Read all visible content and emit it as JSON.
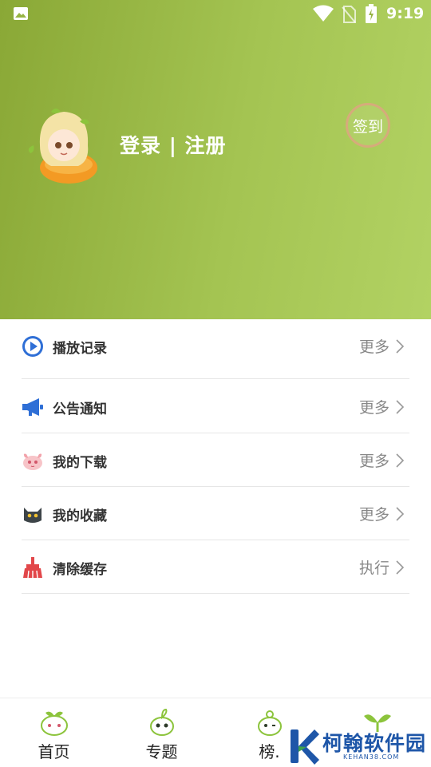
{
  "status_bar": {
    "time": "9:19"
  },
  "header": {
    "login_text": "登录 | 注册",
    "signin_button": "签到",
    "gradient_colors": [
      "#8aa836",
      "#b2d263"
    ]
  },
  "menu": [
    {
      "label": "播放记录",
      "action": "更多",
      "icon": "play-circle-icon"
    },
    {
      "label": "公告通知",
      "action": "更多",
      "icon": "megaphone-icon"
    },
    {
      "label": "我的下载",
      "action": "更多",
      "icon": "pink-creature-icon"
    },
    {
      "label": "我的收藏",
      "action": "更多",
      "icon": "black-cat-icon"
    },
    {
      "label": "清除缓存",
      "action": "执行",
      "icon": "broom-icon"
    }
  ],
  "tabs": [
    {
      "label": "首页",
      "icon": "home-sprout-icon"
    },
    {
      "label": "专题",
      "icon": "topic-sprout-icon"
    },
    {
      "label": "榜.",
      "icon": "rank-sprout-icon"
    },
    {
      "label": "",
      "icon": "sprout-icon"
    }
  ],
  "watermark": {
    "text": "柯翰软件园",
    "sub": "KEHAN38.COM"
  },
  "colors": {
    "accent_blue": "#2f6fd6",
    "broom_red": "#e2474a",
    "text_gray": "#888888"
  }
}
